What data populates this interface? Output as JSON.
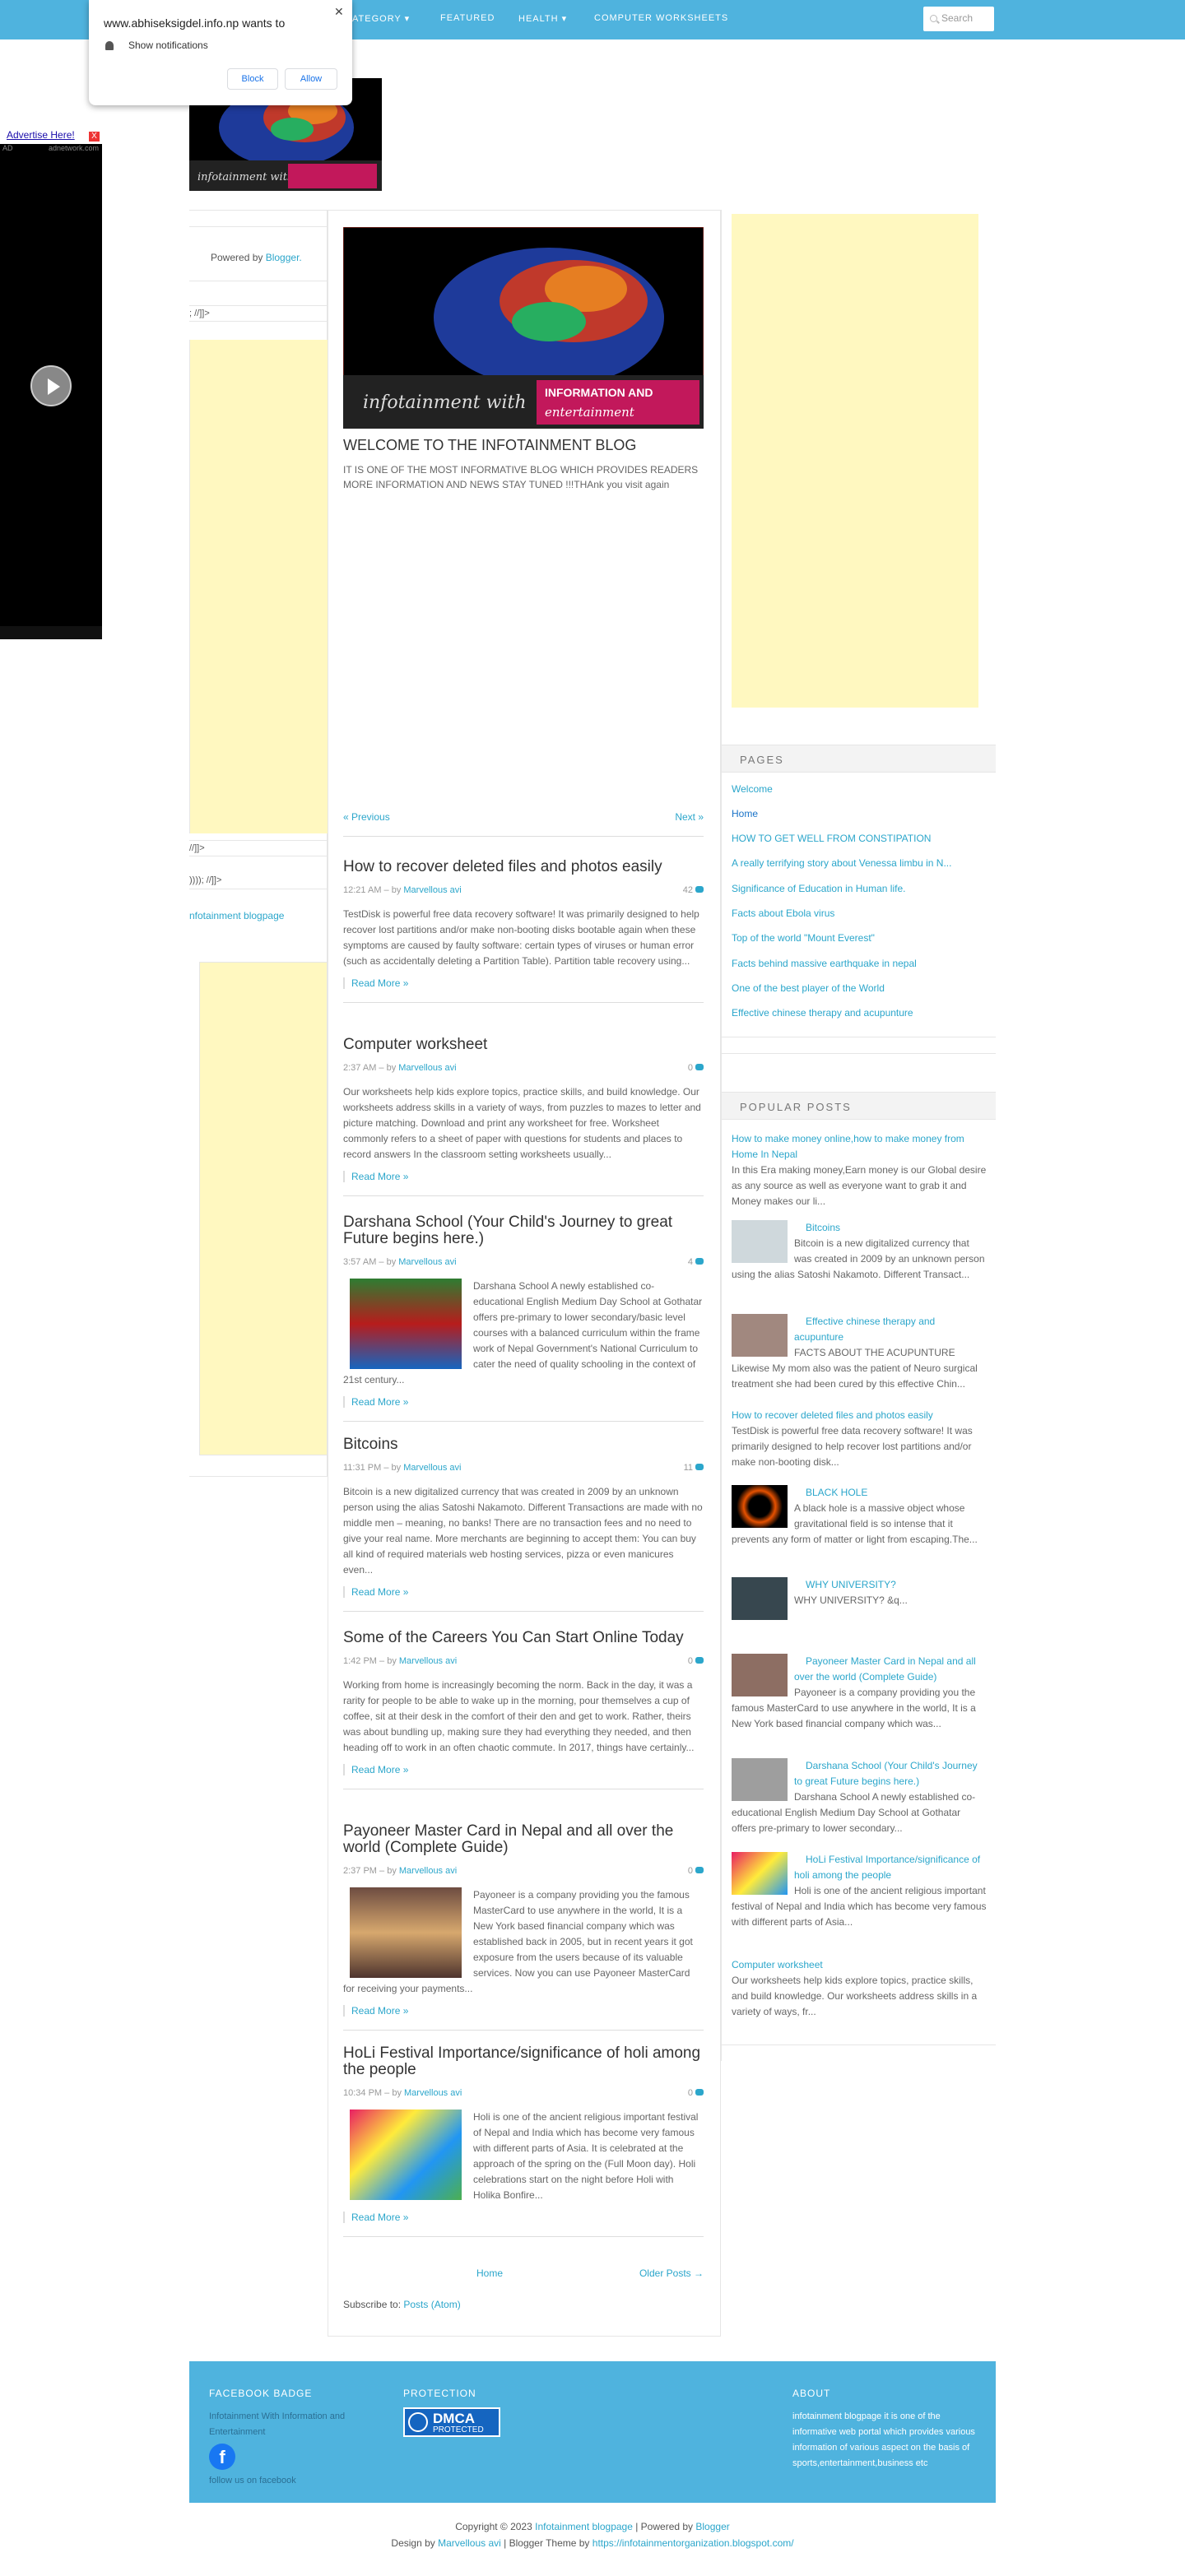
{
  "nav": {
    "items": [
      "ATEGORY",
      "FEATURED",
      "HEALTH",
      "COMPUTER WORKSHEETS"
    ],
    "search_placeholder": "Search"
  },
  "notification": {
    "title": "www.abhiseksigdel.info.np wants to",
    "message": "Show notifications",
    "block": "Block",
    "allow": "Allow"
  },
  "ad": {
    "label": "Advertise Here!",
    "sub_left": "AD",
    "sub_right": "adnetwork.com",
    "close": "X"
  },
  "left": {
    "powered": "Powered by ",
    "powered_link": "Blogger.",
    "frag1": "; //]]>",
    "frag2": "//]]>",
    "frag3": ")))); //]]>",
    "blog_link": "nfotainment blogpage"
  },
  "welcome": {
    "title": "WELCOME TO THE INFOTAINMENT BLOG",
    "text": "IT IS ONE OF THE MOST INFORMATIVE BLOG WHICH PROVIDES READERS MORE INFORMATION AND NEWS STAY TUNED !!!THAnk you visit again",
    "prev": "« Previous",
    "next": "Next »",
    "logo_text1": "infotainment with",
    "logo_text2": "INFORMATION AND",
    "logo_text3": "entertainment"
  },
  "posts": [
    {
      "title": "How to recover deleted files and photos easily",
      "time": "12:21 AM",
      "by": " – by ",
      "author": "Marvellous avi",
      "count": "42",
      "text": "TestDisk is powerful free data recovery software! It was primarily designed to help recover lost partitions and/or make non-booting disks bootable again when these symptoms are caused by faulty software: certain types of viruses or human error (such as accidentally deleting a Partition Table). Partition table recovery using...",
      "more": "Read More »"
    },
    {
      "title": "Computer worksheet",
      "time": "2:37 AM",
      "by": " – by ",
      "author": "Marvellous avi",
      "count": "0",
      "text": "Our worksheets help kids explore topics, practice skills, and build knowledge. Our worksheets address skills in a variety of ways, from puzzles to mazes to letter and picture matching. Download and print any worksheet for free. Worksheet commonly refers to a sheet of paper with questions for students and places to record answers In the classroom setting worksheets usually...",
      "more": "Read More »"
    },
    {
      "title": "Darshana School (Your Child's Journey to great Future begins here.)",
      "time": "3:57 AM",
      "by": " – by ",
      "author": "Marvellous avi",
      "count": "4",
      "text": "Darshana School  A newly established co-educational English Medium Day School at Gothatar offers pre-primary to lower secondary/basic level courses with a balanced curriculum within the frame work of Nepal Government's National Curriculum to cater the need of quality schooling in the context of 21st century...",
      "more": "Read More »",
      "img": "darshana"
    },
    {
      "title": "Bitcoins",
      "time": "11:31 PM",
      "by": " – by ",
      "author": "Marvellous avi",
      "count": "11",
      "text": "Bitcoin is a new digitalized  currency that was created in 2009 by an unknown person using the alias Satoshi Nakamoto. Different Transactions are made with no middle men – meaning, no banks! There are no transaction fees and no need to give your real name. More merchants are beginning to accept them: You can buy all kind of required materials web hosting services, pizza or even manicures even...",
      "more": "Read More »"
    },
    {
      "title": "Some of the Careers You Can Start Online Today",
      "time": "1:42 PM",
      "by": " – by ",
      "author": "Marvellous avi",
      "count": "0",
      "text": "Working from home is increasingly becoming the norm. Back in the day, it was a rarity for people to be able to wake up in the morning, pour themselves a cup of coffee, sit at their desk in the comfort of their den and get to work. Rather, theirs was about bundling up, making sure they had everything they needed, and then heading off to work in an often chaotic commute. In 2017, things have certainly...",
      "more": "Read More »"
    },
    {
      "title": "Payoneer Master Card in Nepal and all over the world (Complete Guide)",
      "time": "2:37 PM",
      "by": " – by ",
      "author": "Marvellous avi",
      "count": "0",
      "text": "Payoneer is a company providing you the famous MasterCard to use anywhere in the world, It is a New York based financial company which was established back in 2005, but in recent years it got exposure from the users because of its valuable services. Now you can use Payoneer MasterCard for receiving your payments...",
      "more": "Read More »",
      "img": "payoneer"
    },
    {
      "title": "HoLi Festival Importance/significance of holi among the people",
      "time": "10:34 PM",
      "by": " – by ",
      "author": "Marvellous avi",
      "count": "0",
      "text": "  Holi is one of the ancient religious important festival of  Nepal and India which has become very famous with different parts of Asia. It  is celebrated at the approach of the spring on the   (Full Moon day).  Holi celebrations start on the night before Holi with Holika Bonfire...",
      "more": "Read More »",
      "img": "holi"
    }
  ],
  "pager": {
    "home": "Home",
    "older": "Older Posts →",
    "subscribe": "Subscribe to: ",
    "subscribe_link": "Posts (Atom)"
  },
  "pages": {
    "title": "PAGES",
    "items": [
      "Welcome",
      "Home",
      "HOW TO GET WELL FROM CONSTIPATION",
      "A really terrifying story about Venessa limbu in N...",
      "Significance of Education in Human life.",
      "Facts about Ebola virus",
      "Top of the world \"Mount Everest\"",
      "Facts behind massive earthquake in nepal",
      "One of the best player of the World",
      "Effective chinese therapy and acupunture"
    ]
  },
  "popular": {
    "title": "POPULAR POSTS",
    "items": [
      {
        "title": "How to make money online,how to make money from Home In Nepal",
        "text": "In this Era making money,Earn money is our Global desire as any source as well as everyone want to grab it and Money makes our li..."
      },
      {
        "title": "Bitcoins",
        "text": "Bitcoin is a new digitalized  currency that was created in 2009 by an unknown person using the alias Satoshi Nakamoto. Different Transact..."
      },
      {
        "title": "Effective chinese therapy and acupunture",
        "text": "FACTS ABOUT THE ACUPUNTURE  Likewise My mom also was the patient of Neuro surgical treatment she had been cured by this effective Chin..."
      },
      {
        "title": "How to recover deleted files and photos easily",
        "text": "TestDisk is  powerful  free data recovery software! It was primarily designed to help recover lost partitions and/or make non-booting disk..."
      },
      {
        "title": "BLACK HOLE",
        "text": "A black hole is a massive object whose gravitational field is so intense that it prevents any form of matter or light from escaping.The..."
      },
      {
        "title": "WHY UNIVERSITY?",
        "text": "WHY   UNIVERSITY?                                                 &q..."
      },
      {
        "title": "Payoneer Master Card in Nepal and all over the world (Complete Guide)",
        "text": "Payoneer is a company providing you the famous MasterCard to use anywhere in the world, It is a New York based financial company which was..."
      },
      {
        "title": "Darshana School (Your Child's Journey to great Future begins here.)",
        "text": "Darshana School  A newly  established co-educational English Medium Day School at Gothatar offers pre-primary to lower secondary..."
      },
      {
        "title": "HoLi Festival Importance/significance of holi among the people",
        "text": "  Holi is one of the ancient religious important festival of  Nepal and India which has become very famous with different parts of Asia..."
      },
      {
        "title": "Computer worksheet",
        "text": "Our worksheets help kids explore topics, practice skills, and build knowledge. Our worksheets address skills in a variety of ways, fr..."
      }
    ]
  },
  "footer": {
    "fb_title": "FACEBOOK BADGE",
    "fb_name": "Infotainment With Information and Entertainment",
    "fb_follow": "follow us on facebook",
    "protection_title": "PROTECTION",
    "dmca": "DMCA",
    "dmca_sub": "PROTECTED",
    "about_title": "ABOUT",
    "about_text": "infotainment blogpage it is one of the informative web portal which provides various information of various aspect on the basis of sports,entertainment,business etc"
  },
  "copyright": {
    "c1": "Copyright © 2023 ",
    "c1_link": "Infotainment blogpage",
    "c2": " | Powered by ",
    "c2_link": "Blogger",
    "d1": "Design by ",
    "d1_link": "Marvellous avi",
    "d2": " | Blogger Theme by ",
    "d2_link": "https://infotainmentorganization.blogspot.com/"
  }
}
